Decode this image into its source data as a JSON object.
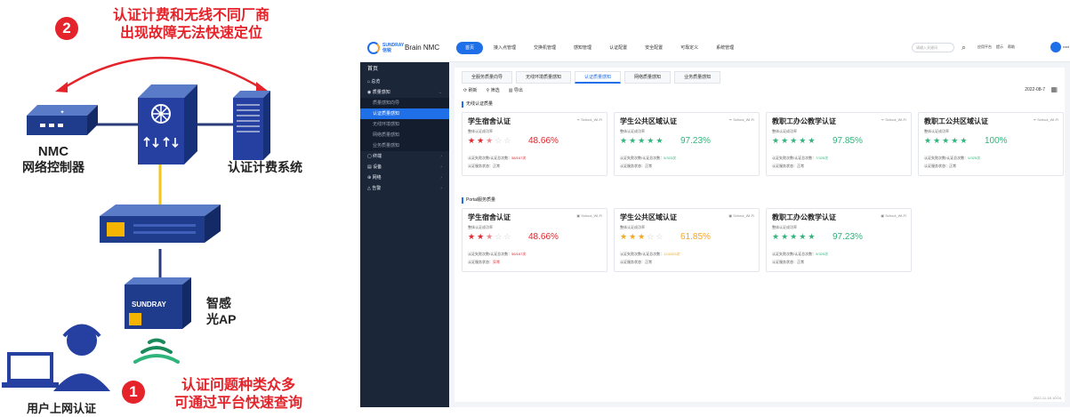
{
  "diagram": {
    "badge_top": "2",
    "top_text_1": "认证计费和无线不同厂商",
    "top_text_2": "出现故障无法快速定位",
    "nmc_label_1": "NMC",
    "nmc_label_2": "网络控制器",
    "billing_label": "认证计费系统",
    "ap_label_1": "智感",
    "ap_label_2": "光AP",
    "ap_brand": "SUNDRAY",
    "user_label": "用户上网认证",
    "badge_bottom": "1",
    "bottom_text_1": "认证问题种类众多",
    "bottom_text_2": "可通过平台快速查询",
    "accent_color": "#e5232a"
  },
  "app": {
    "brand": "Brain NMC",
    "brand_small": "SUNDRAY 信锐",
    "nav": [
      "首页",
      "接入点管理",
      "交换机管理",
      "感知管理",
      "认证配置",
      "安全配置",
      "可靠定义",
      "系统管理"
    ],
    "search_placeholder": "请输入关键词",
    "tools": [
      "应用平台",
      "提示",
      "帮助"
    ],
    "user": "root",
    "sidebar": {
      "home": "首页",
      "items": [
        {
          "label": "总览",
          "type": "grp"
        },
        {
          "label": "质量感知",
          "type": "grp"
        },
        {
          "label": "质量感知向导",
          "type": "sub"
        },
        {
          "label": "认证质量感知",
          "type": "sub sel"
        },
        {
          "label": "无线环境感知",
          "type": "sub"
        },
        {
          "label": "网络质量感知",
          "type": "sub"
        },
        {
          "label": "业务质量感知",
          "type": "sub"
        },
        {
          "label": "终端",
          "type": "grp"
        },
        {
          "label": "设备",
          "type": "grp"
        },
        {
          "label": "网络",
          "type": "grp"
        },
        {
          "label": "告警",
          "type": "grp"
        }
      ]
    },
    "tabs": [
      "全服务质量向导",
      "无线环境质量感知",
      "认证质量感知",
      "网络质量感知",
      "业务质量感知"
    ],
    "toolbar": [
      "刷新",
      "筛选",
      "导出"
    ],
    "date": "2022-08-7",
    "section1": "无线认证质量",
    "section2": "Portal服务质量",
    "cards": [
      {
        "title": "学生宿舍认证",
        "tag": "School_Wi-Fi",
        "label": "整体认证成功率",
        "rating": 2.5,
        "pct": "48.66%",
        "pct_color": "#e5232a",
        "star_color": "#e5232a",
        "line1": "认证失败次数/认证总次数：",
        "ratio": "58/167次",
        "line2": "认证服务状态：正常"
      },
      {
        "title": "学生公共区域认证",
        "tag": "School_Wi-Fi",
        "label": "整体认证成功率",
        "rating": 5,
        "pct": "97.23%",
        "pct_color": "#2fb57b",
        "star_color": "#2fb57b",
        "line1": "认证失败次数/认证总次数：",
        "ratio": "5/323次",
        "line2": "认证服务状态：正常"
      },
      {
        "title": "教职工办公教学认证",
        "tag": "School_Wi-Fi",
        "label": "整体认证成功率",
        "rating": 5,
        "pct": "97.85%",
        "pct_color": "#2fb57b",
        "star_color": "#2fb57b",
        "line1": "认证失败次数/认证总次数：",
        "ratio": "7/325次",
        "line2": "认证服务状态：正常"
      },
      {
        "title": "教职工公共区域认证",
        "tag": "School_Wi-Fi",
        "label": "整体认证成功率",
        "rating": 5,
        "pct": "100%",
        "pct_color": "#2fb57b",
        "star_color": "#2fb57b",
        "line1": "认证失败次数/认证总次数：",
        "ratio": "0/325次",
        "line2": "认证服务状态：正常"
      },
      {
        "title": "学生宿舍认证",
        "tag": "School_Wi-Fi",
        "label": "整体认证成功率",
        "rating": 2.5,
        "pct": "48.66%",
        "pct_color": "#e5232a",
        "star_color": "#e5232a",
        "line1": "认证失败次数/认证总次数：",
        "ratio": "56/167次",
        "line2": "认证服务状态：",
        "status": "异常"
      },
      {
        "title": "学生公共区域认证",
        "tag": "School_Wi-Fi",
        "label": "整体认证成功率",
        "rating": 3,
        "pct": "61.85%",
        "pct_color": "#f5a623",
        "star_color": "#f5a623",
        "line1": "认证失败次数/认证总次数：",
        "ratio": "124/325次",
        "line2": "认证服务状态：正常"
      },
      {
        "title": "教职工办公教学认证",
        "tag": "School_Wi-Fi",
        "label": "整体认证成功率",
        "rating": 5,
        "pct": "97.23%",
        "pct_color": "#2fb57b",
        "star_color": "#2fb57b",
        "line1": "认证失败次数/认证总次数：",
        "ratio": "9/325次",
        "line2": "认证服务状态：正常"
      }
    ],
    "footer_time": "2022-11-18 10:04"
  }
}
